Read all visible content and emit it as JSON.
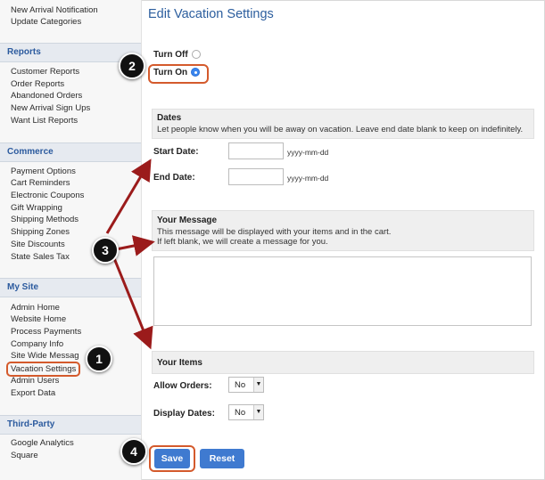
{
  "sidebar": {
    "top_links": [
      "New Arrival Notification",
      "Update Categories"
    ],
    "sections": [
      {
        "title": "Reports",
        "items": [
          "Customer Reports",
          "Order Reports",
          "Abandoned Orders",
          "New Arrival Sign Ups",
          "Want List Reports"
        ]
      },
      {
        "title": "Commerce",
        "items": [
          "Payment Options",
          "Cart Reminders",
          "Electronic Coupons",
          "Gift Wrapping",
          "Shipping Methods",
          "Shipping Zones",
          "Site Discounts",
          "State Sales Tax"
        ]
      },
      {
        "title": "My Site",
        "items": [
          "Admin Home",
          "Website Home",
          "Process Payments",
          "Company Info",
          "Site Wide Messag",
          "Vacation Settings",
          "Admin Users",
          "Export Data"
        ]
      },
      {
        "title": "Third-Party",
        "items": [
          "Google Analytics",
          "Square"
        ]
      }
    ]
  },
  "main": {
    "title": "Edit Vacation Settings",
    "turn_off_label": "Turn Off",
    "turn_on_label": "Turn On",
    "dates": {
      "title": "Dates",
      "description": "Let people know when you will be away on vacation. Leave end date blank to keep on indefinitely.",
      "start_label": "Start Date:",
      "end_label": "End Date:",
      "start_value": "",
      "end_value": "",
      "format_hint": "yyyy-mm-dd"
    },
    "message": {
      "title": "Your Message",
      "line1": "This message will be displayed with your items and in the cart.",
      "line2": "If left blank, we will create a message for you.",
      "value": ""
    },
    "items": {
      "title": "Your Items",
      "allow_orders_label": "Allow Orders:",
      "allow_orders_value": "No",
      "display_dates_label": "Display Dates:",
      "display_dates_value": "No"
    },
    "save_label": "Save",
    "reset_label": "Reset"
  },
  "callouts": [
    "1",
    "2",
    "3",
    "4"
  ],
  "colors": {
    "accent": "#2c5e9e",
    "highlight": "#d45a2c",
    "button": "#3f7ad0",
    "arrow": "#9b1b1b"
  }
}
